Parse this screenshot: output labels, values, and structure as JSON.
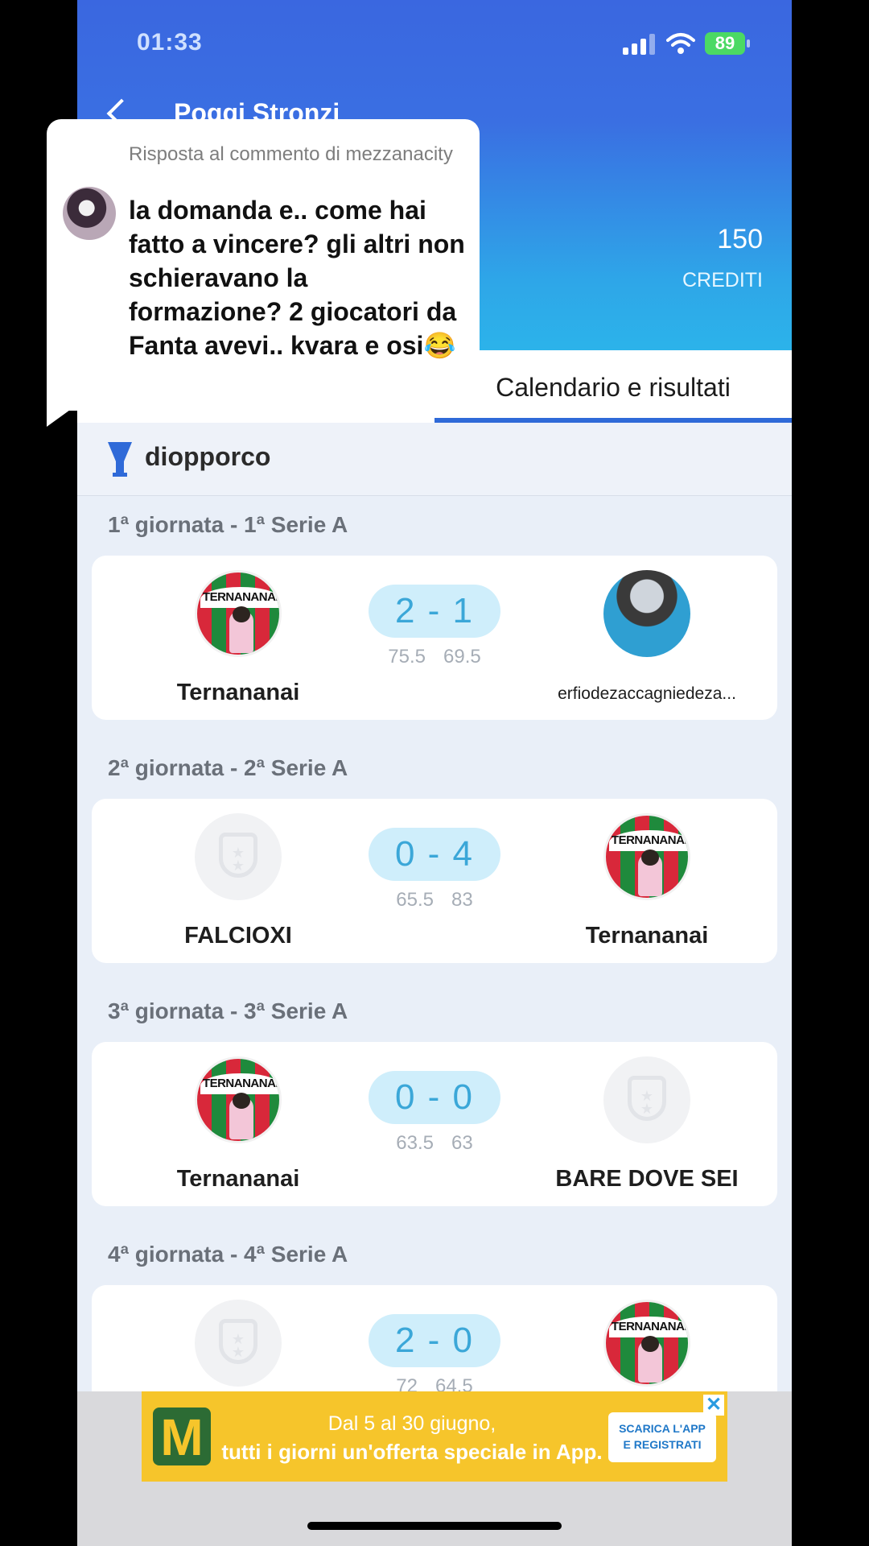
{
  "status_bar": {
    "time": "01:33",
    "battery": "89"
  },
  "header": {
    "league_title": "Poggi Stronzi",
    "credits_value": "150",
    "credits_label": "CREDITI"
  },
  "tabs": {
    "active_label": "Calendario e risultati"
  },
  "competition": {
    "name": "diopporco"
  },
  "matches": [
    {
      "round": "1ª giornata - 1ª Serie A",
      "home": "Ternananai",
      "away": "erfiodezaccagniedeza...",
      "score": "2 - 1",
      "home_points": "75.5",
      "away_points": "69.5"
    },
    {
      "round": "2ª giornata - 2ª Serie A",
      "home": "FALCIOXI",
      "away": "Ternananai",
      "score": "0 - 4",
      "home_points": "65.5",
      "away_points": "83"
    },
    {
      "round": "3ª giornata - 3ª Serie A",
      "home": "Ternananai",
      "away": "BARE DOVE SEI",
      "score": "0 - 0",
      "home_points": "63.5",
      "away_points": "63"
    },
    {
      "round": "4ª giornata - 4ª Serie A",
      "home": "",
      "away": "",
      "score": "2 - 0",
      "home_points": "72",
      "away_points": "64.5"
    }
  ],
  "badge_text": "TERNANANAI",
  "ad": {
    "line1": "Dal 5 al 30 giugno,",
    "line2": "tutti i giorni un'offerta speciale in App.",
    "cta_line1": "SCARICA L'APP",
    "cta_line2": "E REGISTRATI",
    "logo": "M",
    "close": "✕"
  },
  "reply": {
    "heading": "Risposta al commento di mezzanacity",
    "text": "la domanda e.. come hai fatto a vincere? gli altri non schieravano la formazione? 2 giocatori da Fanta avevi.. kvara e osi😂"
  },
  "colors": {
    "header_top": "#3a67e0",
    "header_bottom": "#2cb3ea",
    "tab_indicator": "#2f6ad8",
    "score_pill": "#cfeefb",
    "score_text": "#3ba7d8",
    "ad_bg": "#f6c52b"
  }
}
